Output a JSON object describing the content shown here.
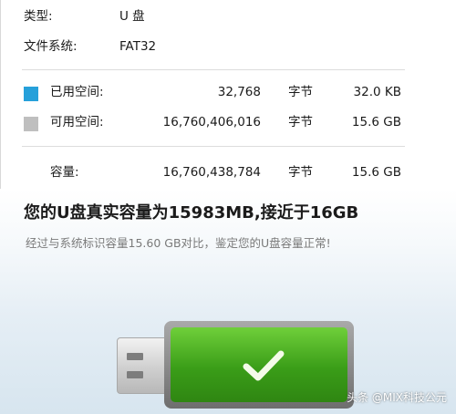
{
  "properties": {
    "type_label": "类型:",
    "type_value": "U 盘",
    "fs_label": "文件系统:",
    "fs_value": "FAT32",
    "used": {
      "label": "已用空间:",
      "bytes": "32,768",
      "unit": "字节",
      "size": "32.0 KB",
      "color": "#26a0da"
    },
    "free": {
      "label": "可用空间:",
      "bytes": "16,760,406,016",
      "unit": "字节",
      "size": "15.6 GB",
      "color": "#bfbfbf"
    },
    "capacity": {
      "label": "容量:",
      "bytes": "16,760,438,784",
      "unit": "字节",
      "size": "15.6 GB"
    }
  },
  "result": {
    "headline": "您的U盘真实容量为15983MB,接近于16GB",
    "subline": "经过与系统标识容量15.60 GB对比，鉴定您的U盘容量正常!",
    "status_icon": "check-icon",
    "status_color": "#3a9d18"
  },
  "watermark": "头条 @MIX科技公元"
}
